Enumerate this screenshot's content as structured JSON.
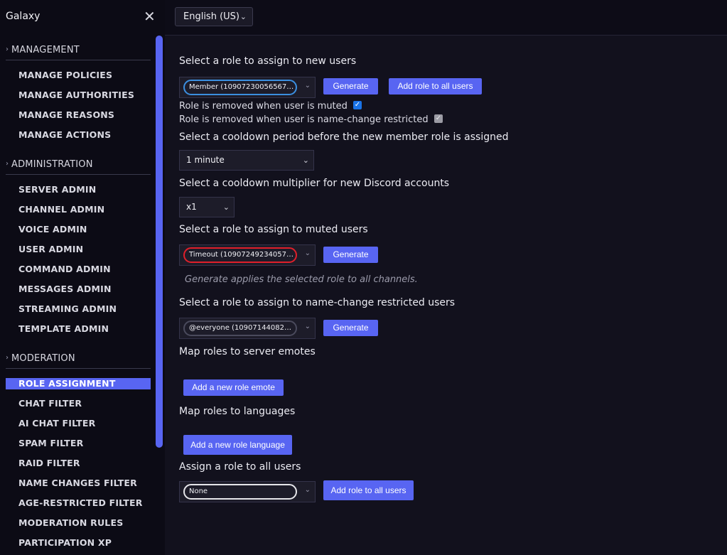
{
  "sidebar": {
    "title": "Galaxy",
    "close_icon": "✕",
    "sections": [
      {
        "label": "MANAGEMENT",
        "items": [
          "MANAGE POLICIES",
          "MANAGE AUTHORITIES",
          "MANAGE REASONS",
          "MANAGE ACTIONS"
        ]
      },
      {
        "label": "ADMINISTRATION",
        "items": [
          "SERVER ADMIN",
          "CHANNEL ADMIN",
          "VOICE ADMIN",
          "USER ADMIN",
          "COMMAND ADMIN",
          "MESSAGES ADMIN",
          "STREAMING ADMIN",
          "TEMPLATE ADMIN"
        ]
      },
      {
        "label": "MODERATION",
        "items": [
          "ROLE ASSIGNMENT",
          "CHAT FILTER",
          "AI CHAT FILTER",
          "SPAM FILTER",
          "RAID FILTER",
          "NAME CHANGES FILTER",
          "AGE-RESTRICTED FILTER",
          "MODERATION RULES",
          "PARTICIPATION XP"
        ]
      }
    ],
    "active_item": "ROLE ASSIGNMENT"
  },
  "topbar": {
    "language": "English (US)"
  },
  "new_users": {
    "label": "Select a role to assign to new users",
    "role": "Member (10907230056567224...",
    "generate": "Generate",
    "add_all": "Add role to all users",
    "muted_check_label": "Role is removed when user is muted",
    "muted_checked": true,
    "restricted_check_label": "Role is removed when user is name-change restricted",
    "restricted_checked": true
  },
  "cooldown": {
    "label": "Select a cooldown period before the new member role is assigned",
    "value": "1 minute"
  },
  "multiplier": {
    "label": "Select a cooldown multiplier for new Discord accounts",
    "value": "x1"
  },
  "muted": {
    "label": "Select a role to assign to muted users",
    "role": "Timeout (10907249234057735...",
    "generate": "Generate",
    "hint": "Generate applies the selected role to all channels."
  },
  "restricted": {
    "label": "Select a role to assign to name-change restricted users",
    "role": "@everyone (10907144082475...",
    "generate": "Generate"
  },
  "emotes": {
    "label": "Map roles to server emotes",
    "button": "Add a new role emote"
  },
  "languages": {
    "label": "Map roles to languages",
    "button": "Add a new role language"
  },
  "assign_all": {
    "label": "Assign a role to all users",
    "role": "None",
    "button": "Add role to all users"
  },
  "colors": {
    "accent": "#5865f2",
    "background": "#12111d",
    "sidebar": "#0c0b15"
  }
}
